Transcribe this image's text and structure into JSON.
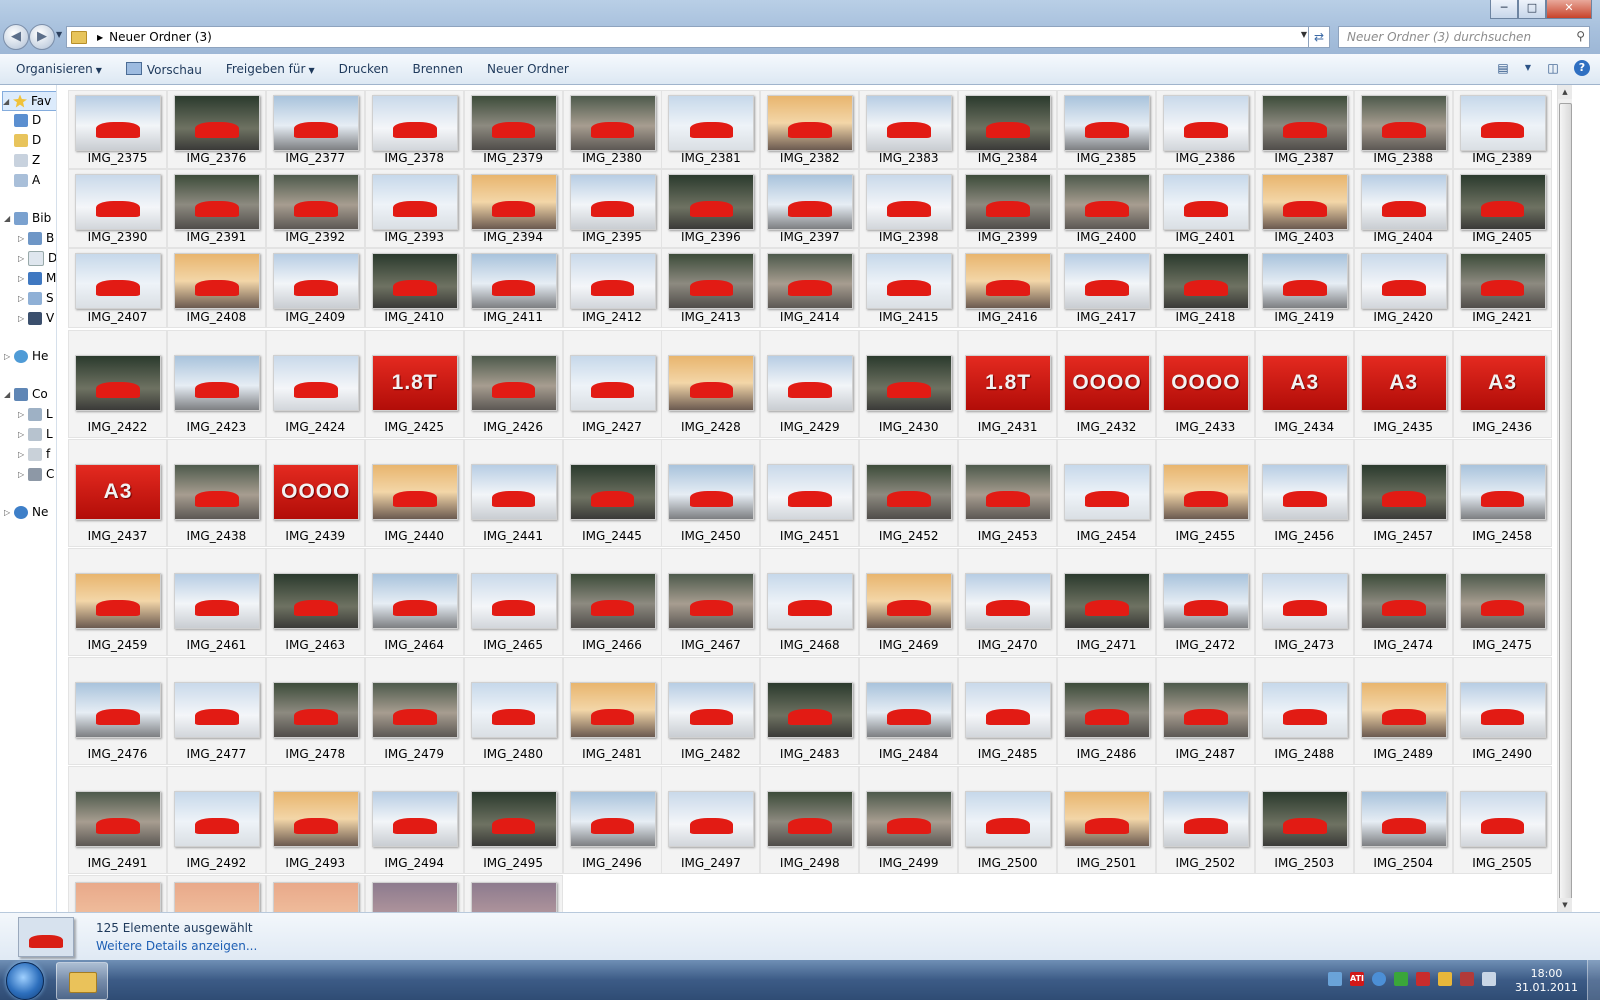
{
  "window": {
    "minimize": "─",
    "maximize": "□",
    "close": "✕"
  },
  "address": {
    "path": "Neuer Ordner (3)",
    "search_placeholder": "Neuer Ordner (3) durchsuchen"
  },
  "toolbar": {
    "organize": "Organisieren",
    "preview": "Vorschau",
    "share": "Freigeben für",
    "print": "Drucken",
    "burn": "Brennen",
    "new_folder": "Neuer Ordner",
    "help": "?"
  },
  "nav": {
    "favorites": "Fav",
    "fav_items": [
      "D",
      "D",
      "Z",
      "A"
    ],
    "libraries": "Bib",
    "lib_items": [
      "B",
      "D",
      "M",
      "S",
      "V"
    ],
    "homegroup": "He",
    "computer": "Co",
    "comp_items": [
      "L",
      "L",
      "f",
      "C"
    ],
    "network": "Ne"
  },
  "files": {
    "rows": [
      [
        "IMG_2375",
        "IMG_2376",
        "IMG_2377",
        "IMG_2378",
        "IMG_2379",
        "IMG_2380",
        "IMG_2381",
        "IMG_2382",
        "IMG_2383",
        "IMG_2384",
        "IMG_2385",
        "IMG_2386",
        "IMG_2387",
        "IMG_2388",
        "IMG_2389"
      ],
      [
        "IMG_2390",
        "IMG_2391",
        "IMG_2392",
        "IMG_2393",
        "IMG_2394",
        "IMG_2395",
        "IMG_2396",
        "IMG_2397",
        "IMG_2398",
        "IMG_2399",
        "IMG_2400",
        "IMG_2401",
        "IMG_2403",
        "IMG_2404",
        "IMG_2405"
      ],
      [
        "IMG_2407",
        "IMG_2408",
        "IMG_2409",
        "IMG_2410",
        "IMG_2411",
        "IMG_2412",
        "IMG_2413",
        "IMG_2414",
        "IMG_2415",
        "IMG_2416",
        "IMG_2417",
        "IMG_2418",
        "IMG_2419",
        "IMG_2420",
        "IMG_2421"
      ],
      [
        "IMG_2422",
        "IMG_2423",
        "IMG_2424",
        "IMG_2425",
        "IMG_2426",
        "IMG_2427",
        "IMG_2428",
        "IMG_2429",
        "IMG_2430",
        "IMG_2431",
        "IMG_2432",
        "IMG_2433",
        "IMG_2434",
        "IMG_2435",
        "IMG_2436"
      ],
      [
        "IMG_2437",
        "IMG_2438",
        "IMG_2439",
        "IMG_2440",
        "IMG_2441",
        "IMG_2445",
        "IMG_2450",
        "IMG_2451",
        "IMG_2452",
        "IMG_2453",
        "IMG_2454",
        "IMG_2455",
        "IMG_2456",
        "IMG_2457",
        "IMG_2458"
      ],
      [
        "IMG_2459",
        "IMG_2461",
        "IMG_2463",
        "IMG_2464",
        "IMG_2465",
        "IMG_2466",
        "IMG_2467",
        "IMG_2468",
        "IMG_2469",
        "IMG_2470",
        "IMG_2471",
        "IMG_2472",
        "IMG_2473",
        "IMG_2474",
        "IMG_2475"
      ],
      [
        "IMG_2476",
        "IMG_2477",
        "IMG_2478",
        "IMG_2479",
        "IMG_2480",
        "IMG_2481",
        "IMG_2482",
        "IMG_2483",
        "IMG_2484",
        "IMG_2485",
        "IMG_2486",
        "IMG_2487",
        "IMG_2488",
        "IMG_2489",
        "IMG_2490"
      ],
      [
        "IMG_2491",
        "IMG_2492",
        "IMG_2493",
        "IMG_2494",
        "IMG_2495",
        "IMG_2496",
        "IMG_2497",
        "IMG_2498",
        "IMG_2499",
        "IMG_2500",
        "IMG_2501",
        "IMG_2502",
        "IMG_2503",
        "IMG_2504",
        "IMG_2505"
      ]
    ],
    "partial_row_count": 5,
    "badge_text": {
      "IMG_2425": "1.8T",
      "IMG_2431": "1.8T",
      "IMG_2432": "OOOO",
      "IMG_2433": "OOOO",
      "IMG_2434": "A3",
      "IMG_2435": "A3",
      "IMG_2436": "A3",
      "IMG_2437": "A3",
      "IMG_2439": "OOOO"
    }
  },
  "details": {
    "count": "125 Elemente ausgewählt",
    "more": "Weitere Details anzeigen..."
  },
  "taskbar": {
    "tray": [
      "ATI"
    ],
    "time": "18:00",
    "date": "31.01.2011"
  },
  "colors": {
    "accent": "#1e5fb4",
    "car_red": "#e21b14"
  }
}
